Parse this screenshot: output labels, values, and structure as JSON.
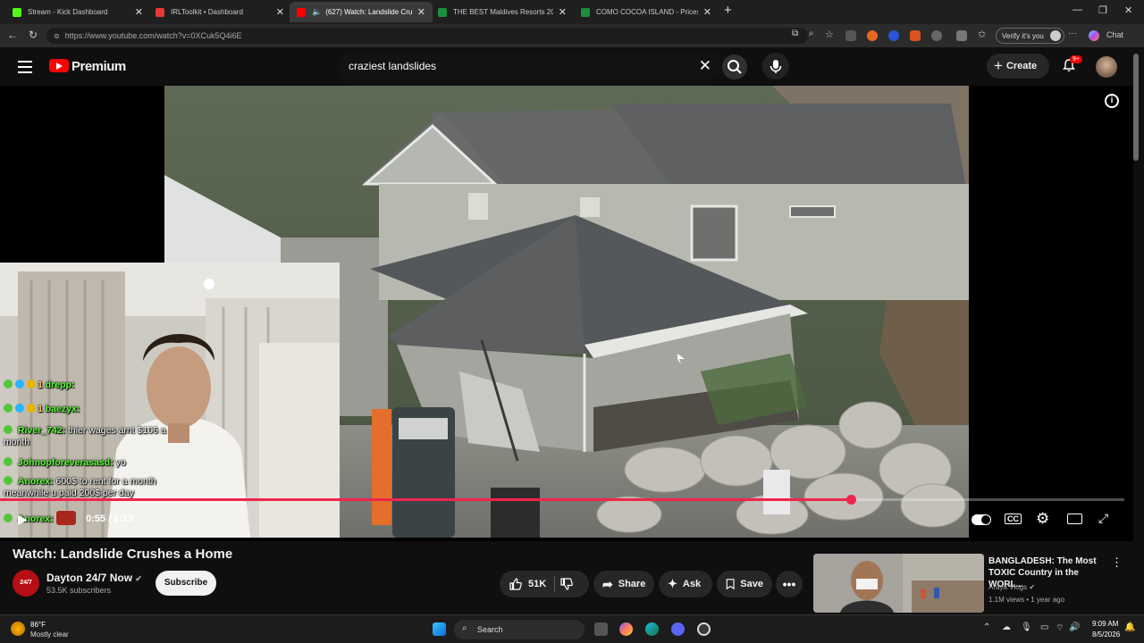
{
  "browser": {
    "tabs": [
      {
        "title": "Stream - Kick Dashboard",
        "color": "#53fc18",
        "active": false
      },
      {
        "title": "IRLToolkit • Dashboard",
        "color": "#e53935",
        "active": false
      },
      {
        "title": "(627) Watch: Landslide Crush",
        "color": "#ff0000",
        "active": true
      },
      {
        "title": "THE BEST Maldives Resorts 2026 (u",
        "color": "#1e8e3e",
        "active": false
      },
      {
        "title": "COMO COCOA ISLAND - Prices &",
        "color": "#1e8e3e",
        "active": false
      }
    ],
    "new_tab": "+",
    "url": "https://www.youtube.com/watch?v=0XCuk5Q4i6E",
    "verify_label": "Verify it's you",
    "chat_label": "Chat",
    "more": "···"
  },
  "youtube": {
    "brand": "Premium",
    "search_query": "craziest landslides",
    "create_label": "Create",
    "notifications_badge": "9+"
  },
  "player": {
    "chat": [
      {
        "user": "drepp:",
        "text": "",
        "has_badges": true
      },
      {
        "user": "baezyx:",
        "text": "",
        "has_badges": true
      },
      {
        "user": "River_742:",
        "text": "thier wages arnt $106 a month",
        "has_badges": false
      },
      {
        "user": "Johnopforeverasasd:",
        "text": "yo",
        "has_badges": false
      },
      {
        "user": "Anorex:",
        "text": "600$ to rent for a month meanwhile u paid 200$ per day",
        "has_badges": false
      },
      {
        "user": "Anorex:",
        "text": "",
        "has_badges": false
      }
    ],
    "chat_badge_number": "1",
    "current_time": "0:55",
    "duration": "1:13",
    "timecode": "0:55 / 1:13",
    "progress": 0.757
  },
  "video": {
    "title": "Watch: Landslide Crushes a Home",
    "channel": "Dayton 24/7 Now",
    "channel_avatar_text": "24/7",
    "subscribers": "53.5K subscribers",
    "subscribe_label": "Subscribe",
    "likes": "51K",
    "share_label": "Share",
    "ask_label": "Ask",
    "save_label": "Save"
  },
  "recommendation": {
    "title": "BANGLADESH: The Most TOXIC Country in the WORL...",
    "channel": "Araya Vlogs",
    "meta": "1.1M views • 1 year ago"
  },
  "taskbar": {
    "temperature": "86°F",
    "weather": "Mostly clear",
    "search_label": "Search",
    "time": "9:09 AM",
    "date": "8/5/2026"
  }
}
